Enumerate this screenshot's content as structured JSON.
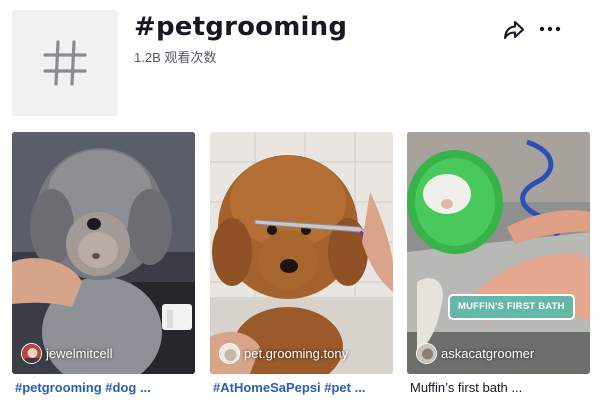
{
  "hashtag": {
    "title": "#petgrooming",
    "views": "1.2B 观看次数",
    "thumb_icon": "hashtag-icon"
  },
  "actions": {
    "share_icon": "share-arrow-icon",
    "more_icon": "more-horizontal-icon"
  },
  "videos": [
    {
      "author": "jewelmitcell",
      "caption": "#petgrooming #dog ...",
      "caption_color": "#2b5db9"
    },
    {
      "author": "pet.grooming.tony",
      "caption": "#AtHomeSaPepsi #pet ...",
      "caption_color": "#2b5db9"
    },
    {
      "author": "askacatgroomer",
      "caption": "Muffin’s first bath ...",
      "caption_color": "#161823",
      "overlay_text": "MUFFIN'S FIRST BATH"
    }
  ],
  "colors": {
    "hashtag_link": "#2b5db9",
    "badge": "#64b8a8",
    "text": "#161823"
  }
}
